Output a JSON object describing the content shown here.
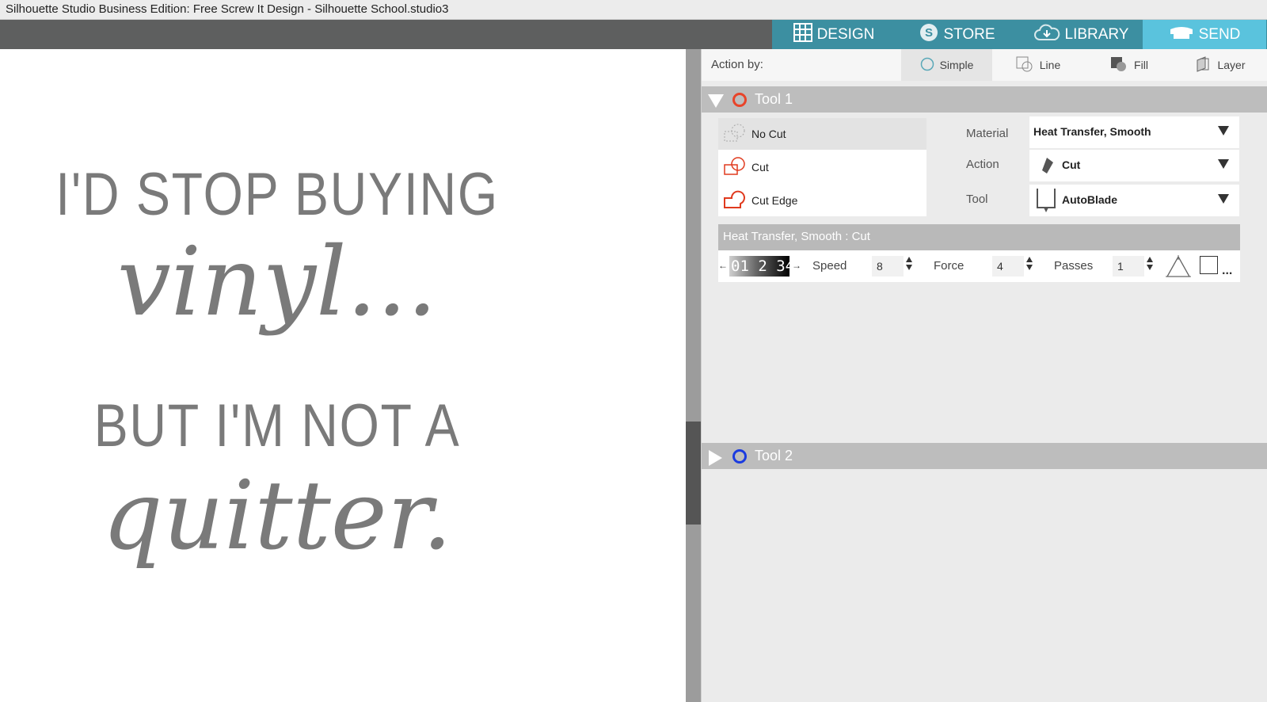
{
  "window": {
    "title": "Silhouette Studio Business Edition: Free Screw It Design - Silhouette School.studio3"
  },
  "nav": {
    "tabs": [
      {
        "label": "DESIGN",
        "icon": "grid-icon"
      },
      {
        "label": "STORE",
        "icon": "store-s-icon"
      },
      {
        "label": "LIBRARY",
        "icon": "cloud-icon"
      },
      {
        "label": "SEND",
        "icon": "cutter-icon",
        "active": true
      }
    ]
  },
  "design": {
    "line1": "I'D STOP BUYING",
    "line2": "vinyl...",
    "line3": "BUT I'M NOT A",
    "line4": "quitter."
  },
  "panel": {
    "action_by_label": "Action by:",
    "modes": [
      {
        "label": "Simple",
        "selected": true
      },
      {
        "label": "Line"
      },
      {
        "label": "Fill"
      },
      {
        "label": "Layer"
      }
    ],
    "tool1": {
      "name": "Tool 1",
      "color": "#e8442a",
      "cut_options": [
        {
          "label": "No Cut",
          "selected": true
        },
        {
          "label": "Cut"
        },
        {
          "label": "Cut Edge"
        }
      ],
      "material_label": "Material",
      "material_value": "Heat Transfer, Smooth",
      "action_label": "Action",
      "action_value": "Cut",
      "tool_label": "Tool",
      "tool_value": "AutoBlade",
      "settings_header": "Heat Transfer, Smooth : Cut",
      "blade_scale": "01 2 34",
      "speed_label": "Speed",
      "speed_value": "8",
      "force_label": "Force",
      "force_value": "4",
      "passes_label": "Passes",
      "passes_value": "1",
      "more": "..."
    },
    "tool2": {
      "name": "Tool 2",
      "color": "#1a3be0"
    }
  }
}
